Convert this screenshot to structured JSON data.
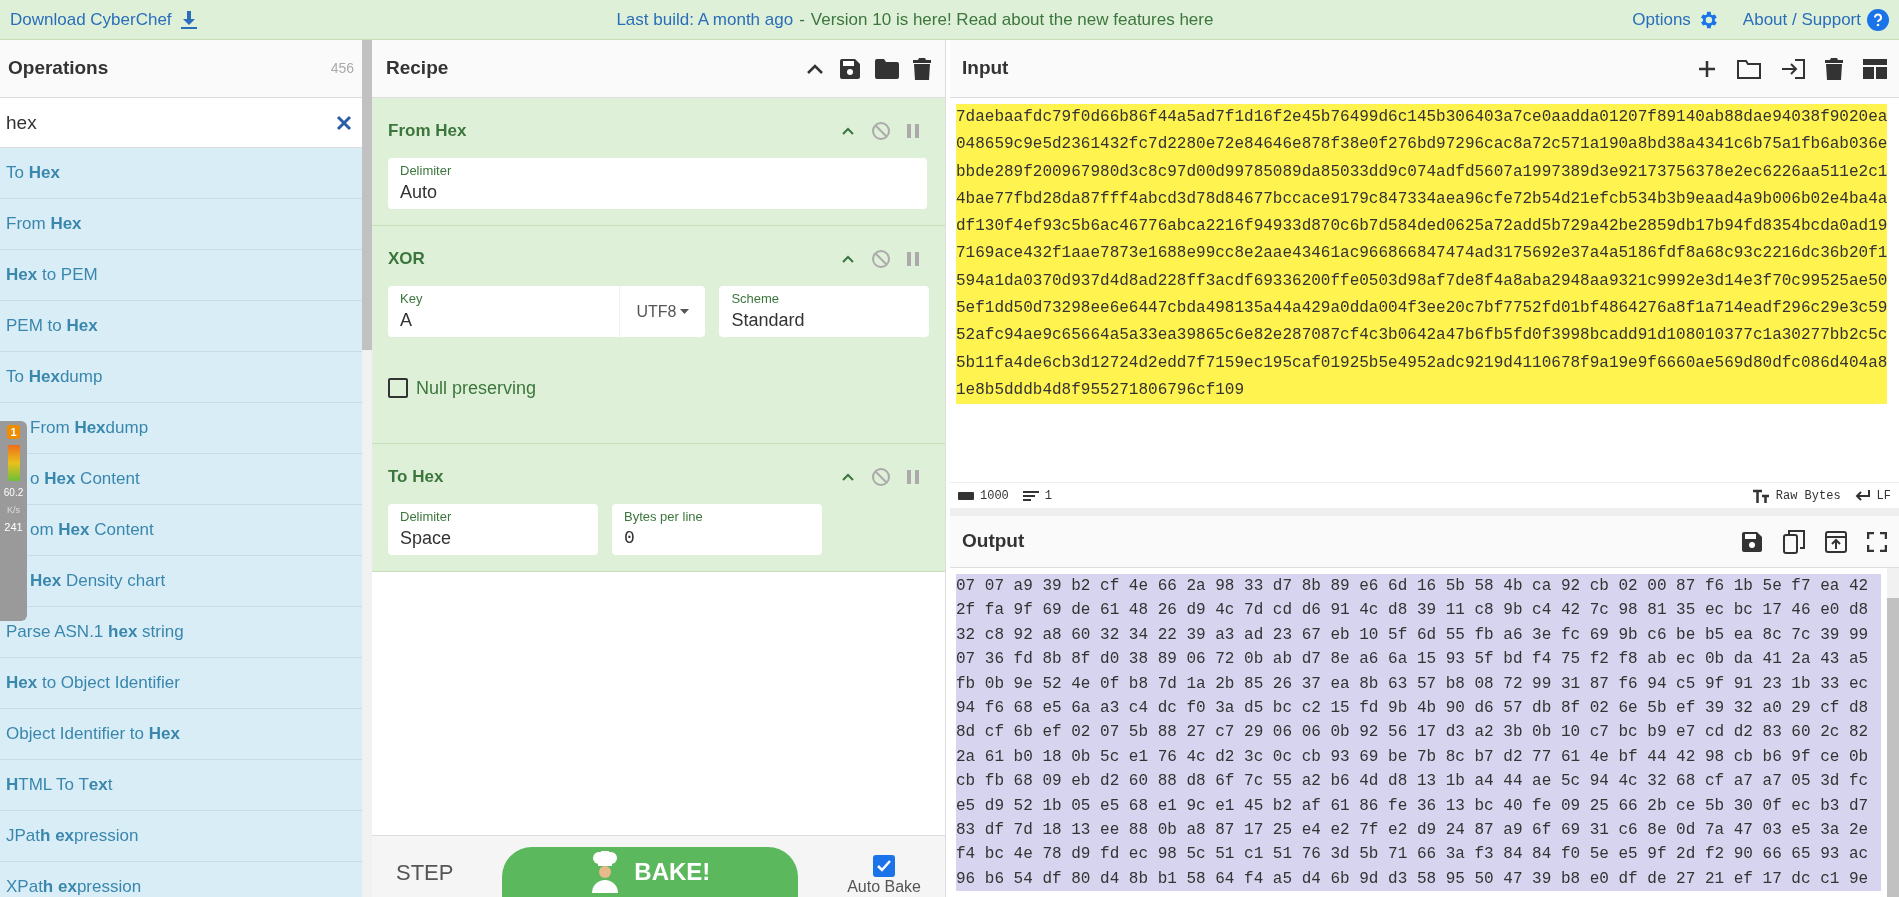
{
  "top_bar": {
    "download": "Download CyberChef",
    "build_link": "Last build: A month ago",
    "separator": "-",
    "notice": "Version 10 is here! Read about the new features here",
    "options": "Options",
    "about": "About / Support"
  },
  "operations": {
    "title": "Operations",
    "count": "456",
    "search": {
      "value": "hex"
    },
    "items": [
      {
        "label": "To **Hex**"
      },
      {
        "label": "From **Hex**"
      },
      {
        "label": "**Hex** to PEM"
      },
      {
        "label": "PEM to **Hex**"
      },
      {
        "label": "To **Hex**dump"
      },
      {
        "label": "From **Hex**dump"
      },
      {
        "label": "o **Hex** Content"
      },
      {
        "label": "om **Hex** Content"
      },
      {
        "label": "**Hex** Density chart"
      },
      {
        "label": "Parse ASN.1 **hex** string"
      },
      {
        "label": "**Hex** to Object Identifier"
      },
      {
        "label": "Object Identifier to **Hex**"
      },
      {
        "label": "**H**TML To T**ex**t"
      },
      {
        "label": "JPat**h** **ex**pression"
      },
      {
        "label": "XPat**h** **ex**pression"
      }
    ]
  },
  "speed_widget": {
    "badge": "1",
    "reading": "60.2",
    "unit": "K/s",
    "count": "241"
  },
  "recipe": {
    "title": "Recipe",
    "ops": [
      {
        "name": "From Hex",
        "args": [
          {
            "kind": "text",
            "label": "Delimiter",
            "value": "Auto"
          }
        ]
      },
      {
        "name": "XOR",
        "args": [
          {
            "kind": "keyed",
            "label": "Key",
            "value": "A",
            "encoding": "UTF8"
          },
          {
            "kind": "text",
            "label": "Scheme",
            "value": "Standard"
          },
          {
            "kind": "checkbox",
            "label": "Null preserving",
            "checked": false
          }
        ]
      },
      {
        "name": "To Hex",
        "args": [
          {
            "kind": "text",
            "label": "Delimiter",
            "value": "Space"
          },
          {
            "kind": "number",
            "label": "Bytes per line",
            "value": "0"
          }
        ]
      }
    ],
    "step": "STEP",
    "bake": "BAKE!",
    "auto_bake": {
      "label": "Auto Bake",
      "checked": true
    }
  },
  "input": {
    "title": "Input",
    "lines": [
      "7daebaafdc79f0d66b86f44a5ad7f1d16f2e45b76499d6c145b306403a7ce0aadda01207f89140ab88dae94038f9020ea",
      "048659c9e5d2361432fc7d2280e72e84646e878f38e0f276bd97296cac8a72c571a190a8bd38a4341c6b75a1fb6ab036e",
      "bbde289f200967980d3c8c97d00d99785089da85033dd9c074adfd5607a1997389d3e92173756378e2ec6226aa511e2c1",
      "4bae77fbd28da87fff4abcd3d78d84677bccace9179c847334aea96cfe72b54d21efcb534b3b9eaad4a9b006b02e4ba4a",
      "df130f4ef93c5b6ac46776abca2216f94933d870c6b7d584ded0625a72add5b729a42be2859db17b94fd8354bcda0ad19",
      "7169ace432f1aae7873e1688e99cc8e2aae43461ac966866847474ad3175692e37a4a5186fdf8a68c93c2216dc36b20f1",
      "594a1da0370d937d4d8ad228ff3acdf69336200ffe0503d98af7de8f4a8aba2948aa9321c9992e3d14e3f70c99525ae50",
      "5ef1dd50d73298ee6e6447cbda498135a44a429a0dda004f3ee20c7bf7752fd01bf4864276a8f1a714eadf296c29e3c59",
      "52afc94ae9c65664a5a33ea39865c6e82e287087cf4c3b0642a47b6fb5fd0f3998bcadd91d108010377c1a30277bb2c5c",
      "5b11fa4de6cb3d12724d2edd7f7159ec195caf01925b5e4952adc9219d4110678f9a19e9f6660ae569d80dfc086d404a8",
      "1e8b5dddb4d8f955271806796cf109"
    ],
    "length": "1000",
    "line_count": "1",
    "encoding": "Raw Bytes",
    "eol": "LF"
  },
  "output": {
    "title": "Output",
    "lines": [
      "07 07 a9 39 b2 cf 4e 66 2a 98 33 d7 8b 89 e6 6d 16 5b 58 4b ca 92 cb 02 00 87 f6 1b 5e f7 ea 42",
      "2f fa 9f 69 de 61 48 26 d9 4c 7d cd d6 91 4c d8 39 11 c8 9b c4 42 7c 98 81 35 ec bc 17 46 e0 d8",
      "32 c8 92 a8 60 32 34 22 39 a3 ad 23 67 eb 10 5f 6d 55 fb a6 3e fc 69 9b c6 be b5 ea 8c 7c 39 99",
      "07 36 fd 8b 8f d0 38 89 06 72 0b ab d7 8e a6 6a 15 93 5f bd f4 75 f2 f8 ab ec 0b da 41 2a 43 a5",
      "fb 0b 9e 52 4e 0f b8 7d 1a 2b 85 26 37 ea 8b 63 57 b8 08 72 99 31 87 f6 94 c5 9f 91 23 1b 33 ec",
      "94 f6 68 e5 6a a3 c4 dc f0 3a d5 bc c2 15 fd 9b 4b 90 d6 57 db 8f 02 6e 5b ef 39 32 a0 29 cf d8",
      "8d cf 6b ef 02 07 5b 88 27 c7 29 06 06 0b 92 56 17 d3 a2 3b 0b 10 c7 bc b9 e7 cd d2 83 60 2c 82",
      "2a 61 b0 18 0b 5c e1 76 4c d2 3c 0c cb 93 69 be 7b 8c b7 d2 77 61 4e bf 44 42 98 cb b6 9f ce 0b",
      "cb fb 68 09 eb d2 60 88 d8 6f 7c 55 a2 b6 4d d8 13 1b a4 44 ae 5c 94 4c 32 68 cf a7 a7 05 3d fc",
      "e5 d9 52 1b 05 e5 68 e1 9c e1 45 b2 af 61 86 fe 36 13 bc 40 fe 09 25 66 2b ce 5b 30 0f ec b3 d7",
      "83 df 7d 18 13 ee 88 0b a8 87 17 25 e4 e2 7f e2 d9 24 87 a9 6f 69 31 c6 8e 0d 7a 47 03 e5 3a 2e",
      "f4 bc 4e 78 d9 fd ec 98 5c 51 c1 51 76 3d 5b 71 66 3a f3 84 84 f0 5e e5 9f 2d f2 90 66 65 93 ac",
      "96 b6 54 df 80 d4 8b b1 58 64 f4 a5 d4 6b 9d d3 58 95 50 47 39 b8 e0 df de 27 21 ef 17 dc c1 9e"
    ]
  }
}
